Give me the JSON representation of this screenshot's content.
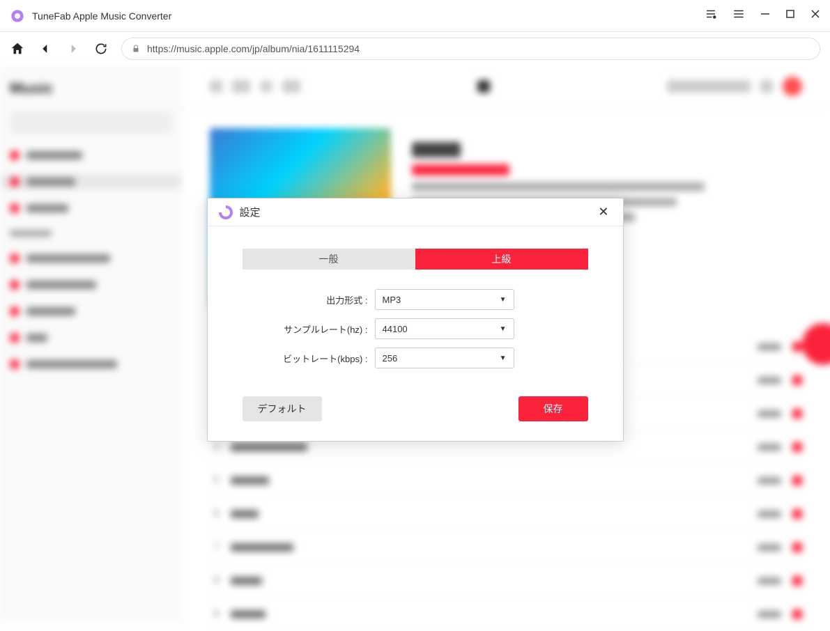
{
  "titlebar": {
    "app_name": "TuneFab Apple Music Converter"
  },
  "url": "https://music.apple.com/jp/album/nia/1611115294",
  "modal": {
    "title": "設定",
    "tab_general": "一般",
    "tab_advanced": "上級",
    "fields": {
      "format_label": "出力形式 :",
      "format_value": "MP3",
      "samplerate_label": "サンプルレート(hz) :",
      "samplerate_value": "44100",
      "bitrate_label": "ビットレート(kbps) :",
      "bitrate_value": "256"
    },
    "btn_default": "デフォルト",
    "btn_save": "保存"
  }
}
